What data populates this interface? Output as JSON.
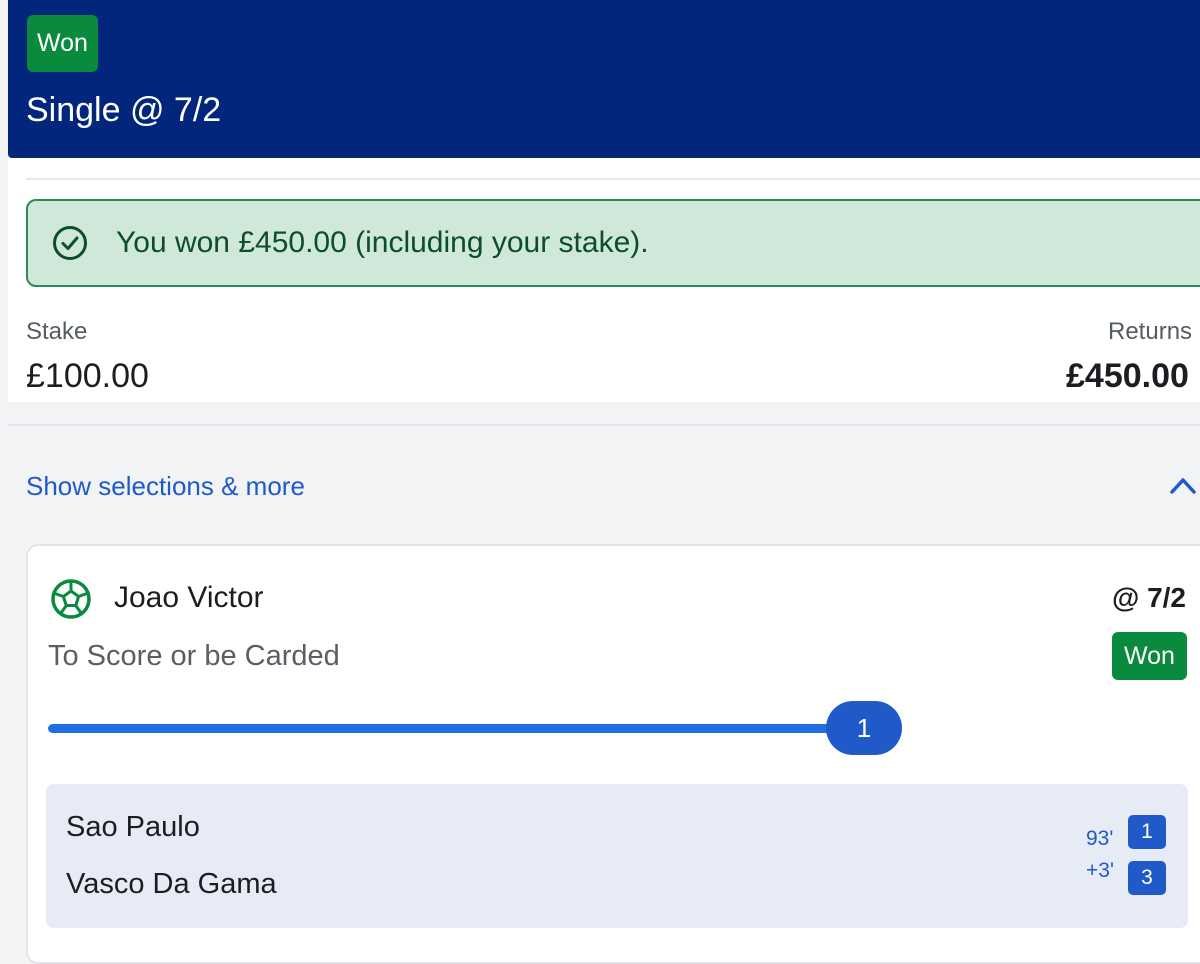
{
  "header": {
    "status_badge": "Won",
    "title": "Single @ 7/2",
    "color": "#01267c"
  },
  "result": {
    "message": "You won £450.00 (including your stake).",
    "icon": "check-circle-icon"
  },
  "stake": {
    "label": "Stake",
    "value": "£100.00"
  },
  "returns": {
    "label": "Returns",
    "value": "£450.00"
  },
  "selections_toggle": {
    "label": "Show selections & more",
    "icon": "chevron-up-icon"
  },
  "selection": {
    "sport_icon": "football-icon",
    "player": "Joao Victor",
    "market": "To Score or be Carded",
    "odds": "@ 7/2",
    "status": "Won",
    "progress_count": "1",
    "progress_fraction": 1.0
  },
  "match": {
    "home_team": "Sao Paulo",
    "away_team": "Vasco Da Gama",
    "minute": "93'",
    "added_time": "+3'",
    "home_score": "1",
    "away_score": "3"
  },
  "colors": {
    "won_green": "#0a8a3c",
    "accent_blue": "#1f5ac8",
    "banner_bg": "#cfe8d9"
  }
}
